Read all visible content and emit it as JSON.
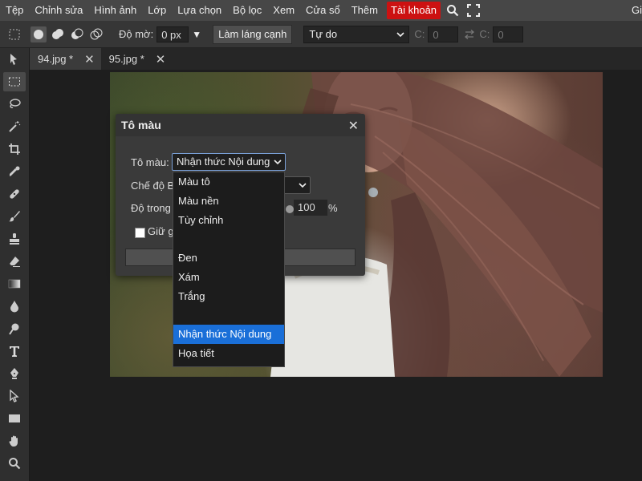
{
  "colors": {
    "accent": "#cc1111",
    "selection": "#1a6fd8"
  },
  "menu": {
    "items": [
      "Tệp",
      "Chỉnh sửa",
      "Hình ảnh",
      "Lớp",
      "Lựa chọn",
      "Bộ lọc",
      "Xem",
      "Cửa sổ",
      "Thêm"
    ],
    "account": "Tài khoản",
    "cut_text": "Gi",
    "icons": [
      "search-icon",
      "fullscreen-icon"
    ]
  },
  "options": {
    "feather_label": "Độ mờ:",
    "feather_value": "0 px",
    "antialias_label": "Làm láng cạnh",
    "style_value": "Tự do",
    "width_label": "C:",
    "width_value": "0",
    "height_label": "C:",
    "height_value": "0",
    "swap_icon": "swap-icon"
  },
  "tools": [
    "move-icon",
    "marquee-icon",
    "lasso-icon",
    "magic-wand-icon",
    "crop-icon",
    "eyedropper-icon",
    "healing-icon",
    "brush-icon",
    "stamp-icon",
    "eraser-icon",
    "gradient-icon",
    "blur-icon",
    "dodge-icon",
    "type-icon",
    "pen-icon",
    "path-select-icon",
    "shape-icon",
    "hand-icon",
    "zoom-icon"
  ],
  "tabs": [
    {
      "label": "94.jpg *",
      "active": true
    },
    {
      "label": "95.jpg *",
      "active": false
    }
  ],
  "dialog": {
    "title": "Tô màu",
    "fill_label": "Tô màu:",
    "fill_value": "Nhận thức Nội dung",
    "blend_label": "Chế độ B",
    "opacity_label": "Độ trong",
    "opacity_value": "100",
    "opacity_unit": "%",
    "preserve_label": "Giữ g"
  },
  "dropdown": {
    "groups": [
      [
        "Màu tô",
        "Màu nền",
        "Tùy chỉnh"
      ],
      [
        "Đen",
        "Xám",
        "Trắng"
      ],
      [
        "Nhận thức Nội dung",
        "Họa tiết"
      ]
    ],
    "selected": "Nhận thức Nội dung"
  }
}
